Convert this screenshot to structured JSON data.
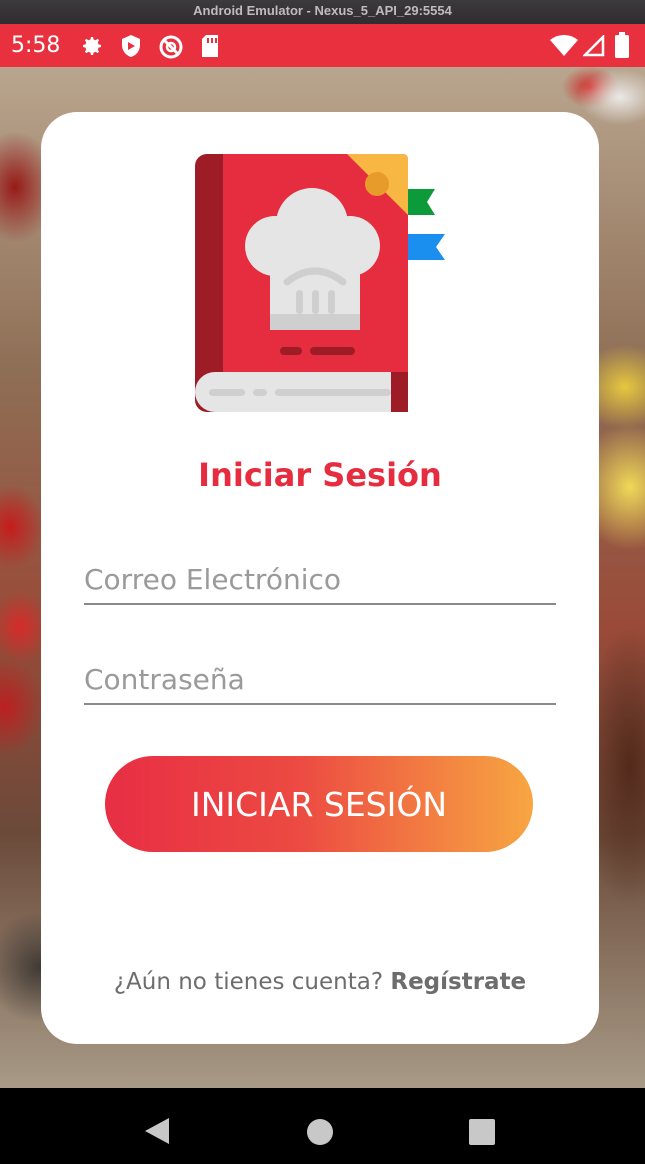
{
  "window": {
    "title": "Android Emulator - Nexus_5_API_29:5554"
  },
  "status_bar": {
    "time": "5:58",
    "icons": [
      "gear-icon",
      "shield-icon",
      "no-sync-icon",
      "sd-card-icon",
      "wifi-icon",
      "signal-icon",
      "battery-icon"
    ],
    "background_color": "#e8303f"
  },
  "card": {
    "logo": "chef-recipe-book-logo",
    "heading": "Iniciar Sesión",
    "email": {
      "placeholder": "Correo Electrónico",
      "value": ""
    },
    "password": {
      "placeholder": "Contraseña",
      "value": ""
    },
    "login_button": "INICIAR SESIÓN",
    "register_prompt": "¿Aún no tienes cuenta?",
    "register_link": "Regístrate"
  },
  "nav_bar": {
    "buttons": [
      "back-icon",
      "home-icon",
      "recents-icon"
    ]
  },
  "colors": {
    "accent": "#e52d3f",
    "gradient_start": "#e82e44",
    "gradient_end": "#f7a642"
  }
}
